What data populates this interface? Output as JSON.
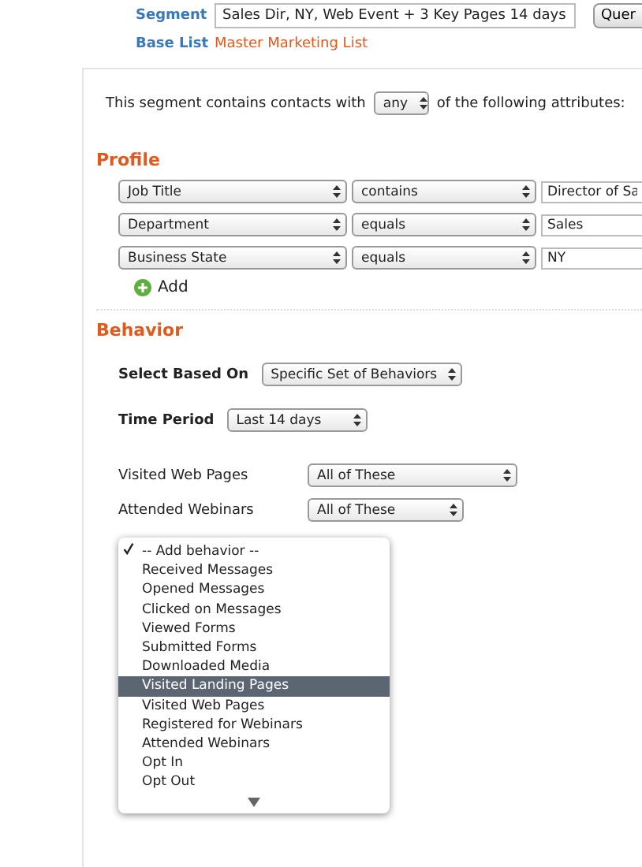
{
  "segment": {
    "label": "Segment",
    "value": "Sales Dir, NY, Web Event + 3 Key Pages 14 days"
  },
  "query_button": "Quer",
  "base_list": {
    "label": "Base List",
    "value": "Master Marketing List"
  },
  "criteria": {
    "before": "This segment contains contacts with",
    "match": "any",
    "after": "of the following attributes:"
  },
  "profile": {
    "title": "Profile",
    "rows": [
      {
        "attribute": "Job Title",
        "operator": "contains",
        "value": "Director of Sa"
      },
      {
        "attribute": "Department",
        "operator": "equals",
        "value": "Sales"
      },
      {
        "attribute": "Business State",
        "operator": "equals",
        "value": "NY"
      }
    ],
    "add": "Add"
  },
  "behavior": {
    "title": "Behavior",
    "settings": [
      {
        "label": "Select Based On",
        "value": "Specific Set of Behaviors"
      },
      {
        "label": "Time Period",
        "value": "Last 14 days"
      }
    ],
    "behaviors": [
      {
        "label": "Visited Web Pages",
        "value": "All of These"
      },
      {
        "label": "Attended Webinars",
        "value": "All of These"
      }
    ],
    "menu": [
      {
        "label": "-- Add behavior --",
        "checked": true,
        "selected": false
      },
      {
        "label": "Received Messages",
        "checked": false,
        "selected": false
      },
      {
        "label": "Opened Messages",
        "checked": false,
        "selected": false
      },
      {
        "label": "Clicked on Messages",
        "checked": false,
        "selected": false
      },
      {
        "label": "Viewed Forms",
        "checked": false,
        "selected": false
      },
      {
        "label": "Submitted Forms",
        "checked": false,
        "selected": false
      },
      {
        "label": "Downloaded Media",
        "checked": false,
        "selected": false
      },
      {
        "label": "Visited Landing Pages",
        "checked": false,
        "selected": true
      },
      {
        "label": "Visited Web Pages",
        "checked": false,
        "selected": false
      },
      {
        "label": "Registered for Webinars",
        "checked": false,
        "selected": false
      },
      {
        "label": "Attended Webinars",
        "checked": false,
        "selected": false
      },
      {
        "label": "Opt In",
        "checked": false,
        "selected": false
      },
      {
        "label": "Opt Out",
        "checked": false,
        "selected": false
      }
    ]
  }
}
